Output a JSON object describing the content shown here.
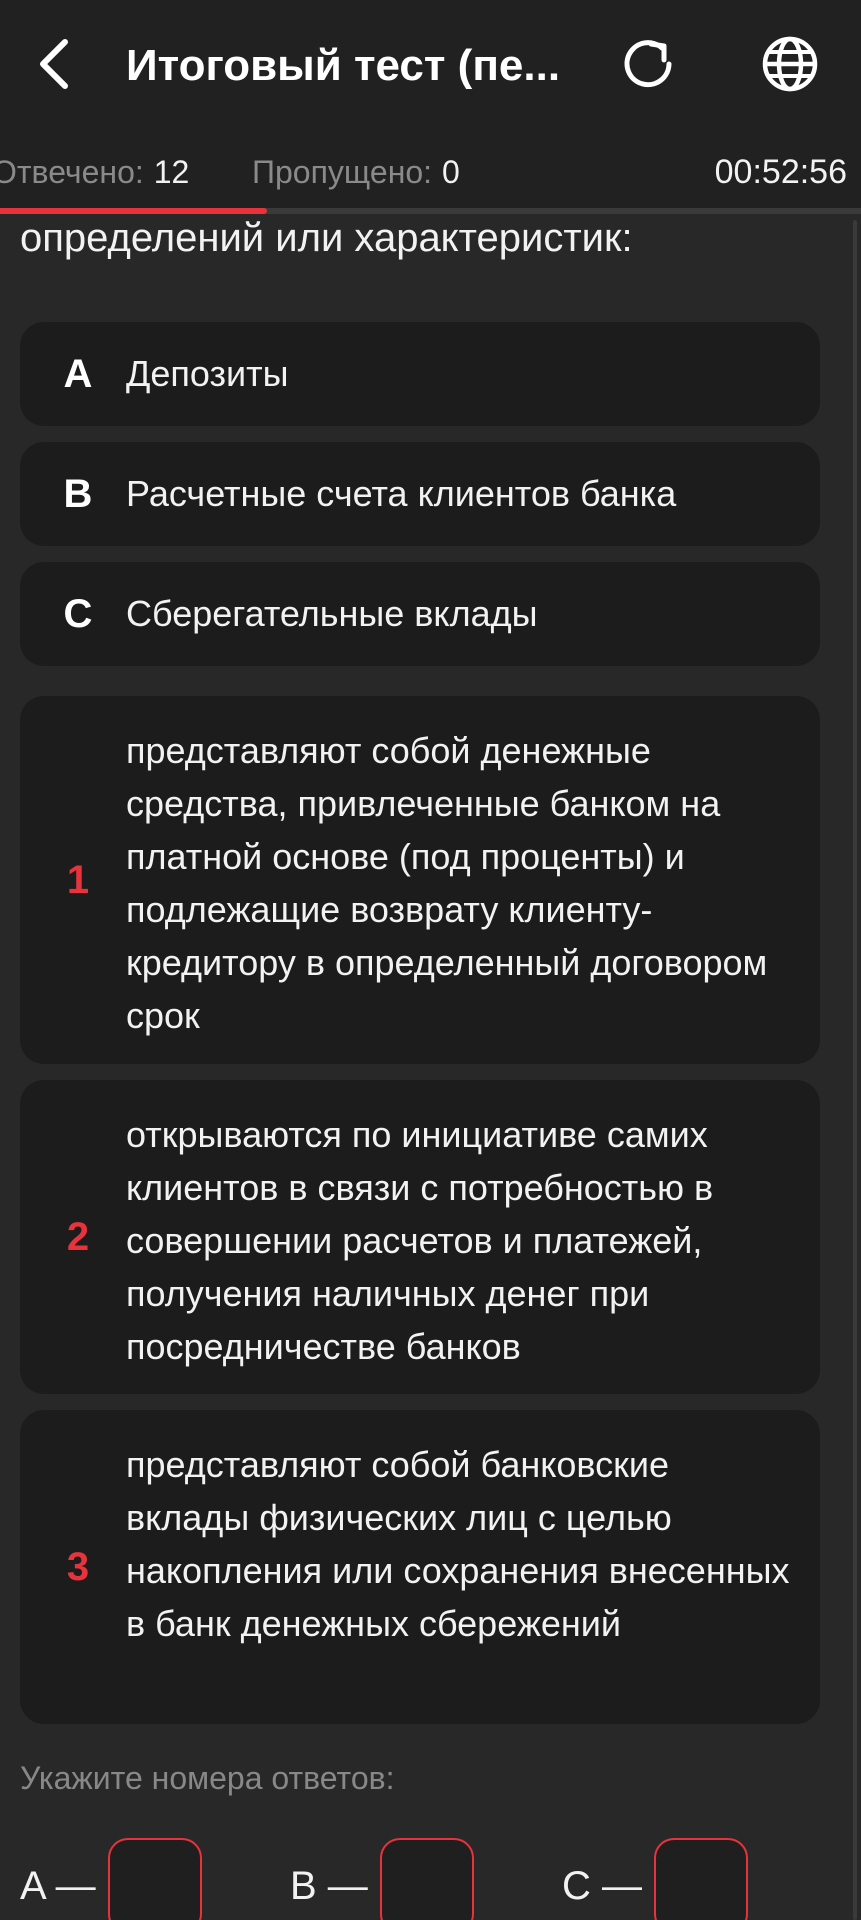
{
  "header": {
    "title": "Итоговый тест (пе...",
    "back_icon": "chevron-left-icon",
    "reload_icon": "reload-icon",
    "language_icon": "globe-icon"
  },
  "status": {
    "answered_label": "Отвечено:",
    "answered_value": "12",
    "skipped_label": "Пропущено:",
    "skipped_value": "0",
    "timer": "00:52:56",
    "progress_fraction": 0.31
  },
  "question": {
    "text": "Установите соответствие понятий и их определений или характеристик:"
  },
  "options_letters": [
    {
      "key": "A",
      "text": "Депозиты"
    },
    {
      "key": "B",
      "text": "Расчетные счета клиентов банка"
    },
    {
      "key": "C",
      "text": "Сберегательные вклады"
    }
  ],
  "options_numbers": [
    {
      "key": "1",
      "text": "представляют собой денежные средства, привлеченные банком на платной основе (под проценты) и подлежащие возврату клиенту-кредитору в определенный договором срок"
    },
    {
      "key": "2",
      "text": "открываются по инициативе самих клиентов в связи с потребностью в совершении расчетов и платежей, получения наличных денег при посредничестве банков"
    },
    {
      "key": "3",
      "text": "представляют собой банковские вклады физических лиц с целью накопления или сохранения внесенных в банк денежных сбережений"
    }
  ],
  "answer": {
    "prompt": "Укажите номера ответов:",
    "slots": [
      {
        "label": "A —",
        "value": ""
      },
      {
        "label": "B —",
        "value": ""
      },
      {
        "label": "C —",
        "value": ""
      }
    ]
  },
  "colors": {
    "accent": "#e8323c",
    "background": "#282828",
    "card": "#1c1c1c",
    "topbar": "#212121"
  }
}
